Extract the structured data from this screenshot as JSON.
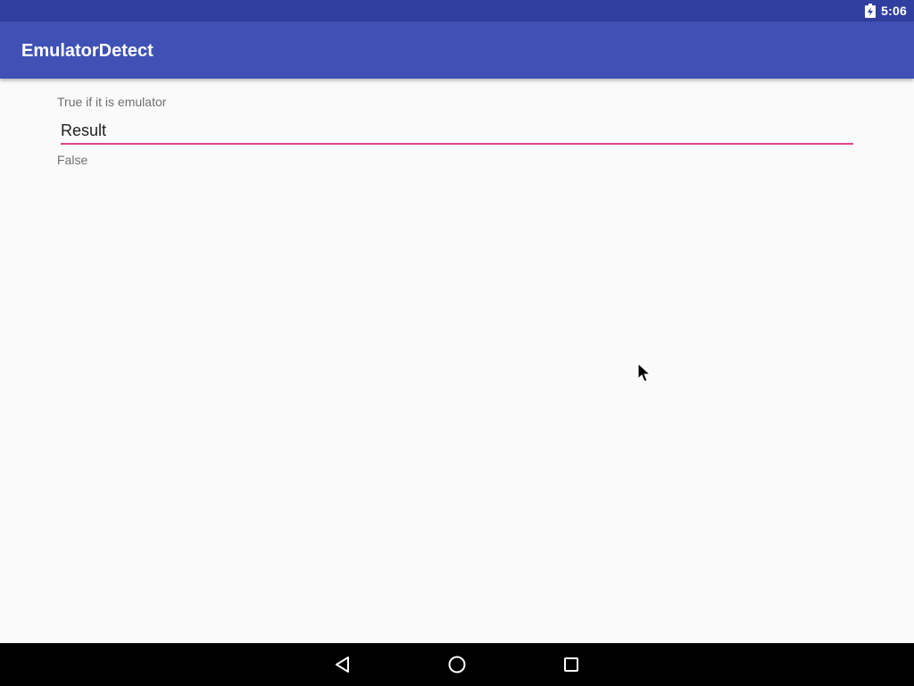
{
  "status_bar": {
    "time": "5:06",
    "icons": [
      "battery-charging-icon"
    ]
  },
  "app_bar": {
    "title": "EmulatorDetect"
  },
  "main": {
    "caption": "True if it is emulator",
    "result_field": {
      "value": "Result"
    },
    "result_value": "False"
  },
  "nav_bar": {
    "buttons": [
      "back-icon",
      "home-icon",
      "recents-icon"
    ]
  },
  "colors": {
    "status_bar": "#303f9f",
    "app_bar": "#3f51b5",
    "accent": "#e0458a",
    "background": "#fafafa",
    "nav_bar": "#000000"
  }
}
